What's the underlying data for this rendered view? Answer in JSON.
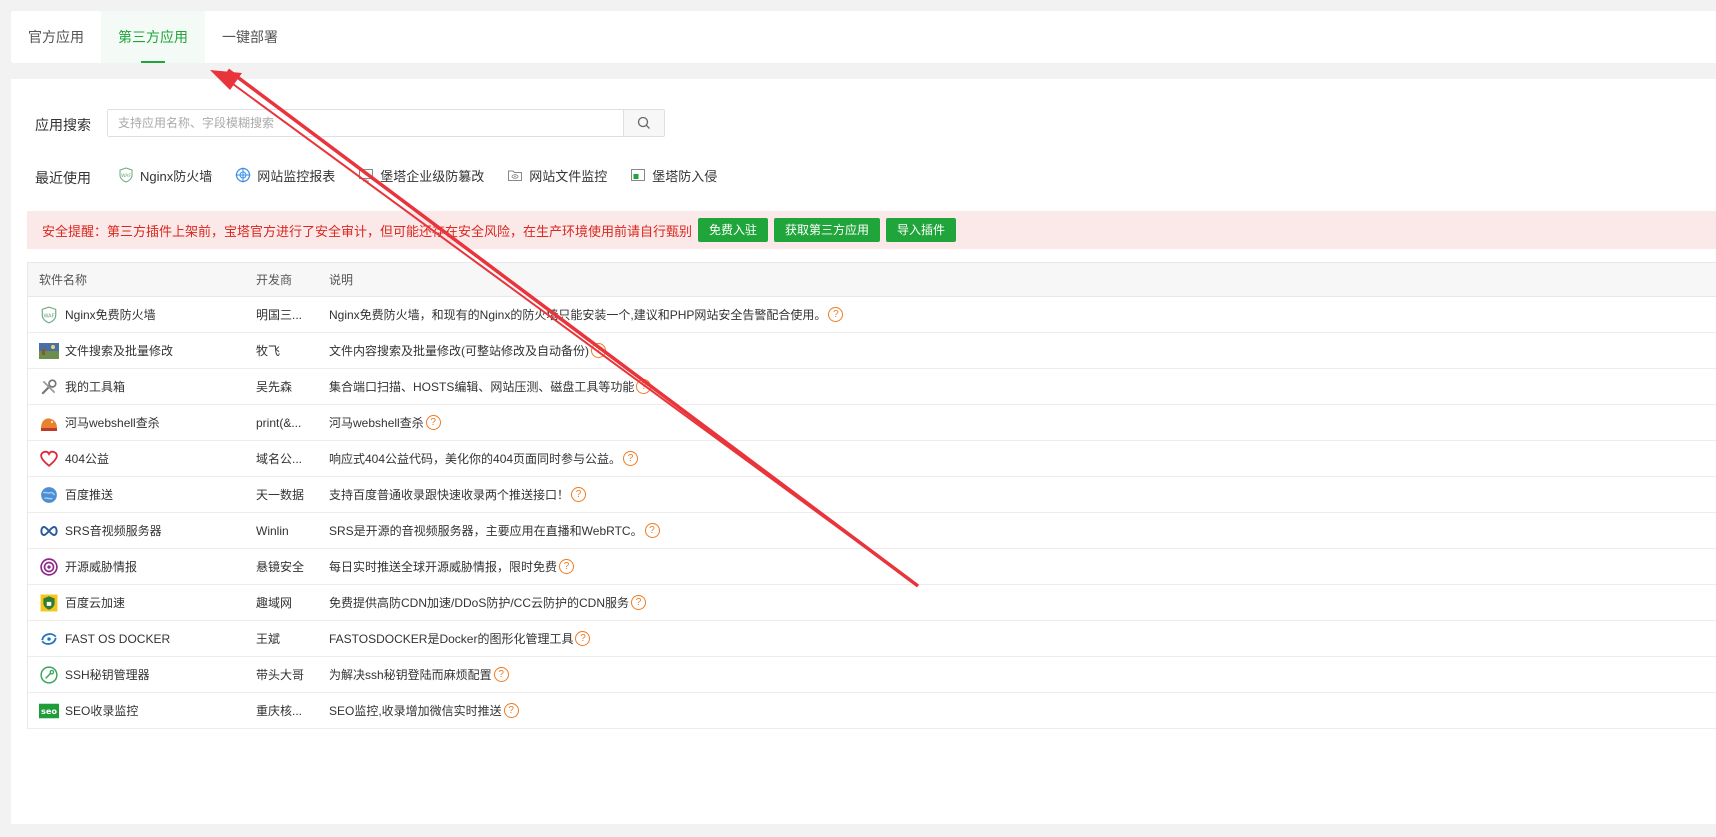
{
  "tabs": [
    {
      "label": "官方应用"
    },
    {
      "label": "第三方应用"
    },
    {
      "label": "一键部署"
    }
  ],
  "search": {
    "label": "应用搜索",
    "placeholder": "支持应用名称、字段模糊搜索"
  },
  "recent": {
    "label": "最近使用",
    "items": [
      {
        "label": "Nginx防火墙"
      },
      {
        "label": "网站监控报表"
      },
      {
        "label": "堡塔企业级防篡改"
      },
      {
        "label": "网站文件监控"
      },
      {
        "label": "堡塔防入侵"
      }
    ]
  },
  "alert": {
    "text": "安全提醒：第三方插件上架前，宝塔官方进行了安全审计，但可能还存在安全风险，在生产环境使用前请自行甄别",
    "buttons": [
      {
        "label": "免费入驻"
      },
      {
        "label": "获取第三方应用"
      },
      {
        "label": "导入插件"
      }
    ]
  },
  "table": {
    "headers": [
      "软件名称",
      "开发商",
      "说明"
    ],
    "rows": [
      {
        "name": "Nginx免费防火墙",
        "dev": "明国三...",
        "desc": "Nginx免费防火墙，和现有的Nginx的防火墙只能安装一个,建议和PHP网站安全告警配合使用。",
        "icon": "waf-shield-icon"
      },
      {
        "name": "文件搜索及批量修改",
        "dev": "牧飞",
        "desc": "文件内容搜索及批量修改(可整站修改及自动备份)",
        "icon": "landscape-image-icon"
      },
      {
        "name": "我的工具箱",
        "dev": "吴先森",
        "desc": "集合端口扫描、HOSTS编辑、网站压测、磁盘工具等功能",
        "icon": "tools-icon"
      },
      {
        "name": "河马webshell查杀",
        "dev": "print(&...",
        "desc": "河马webshell查杀",
        "icon": "hippo-icon"
      },
      {
        "name": "404公益",
        "dev": "域名公...",
        "desc": "响应式404公益代码，美化你的404页面同时参与公益。",
        "icon": "heart-icon"
      },
      {
        "name": "百度推送",
        "dev": "天一数据",
        "desc": "支持百度普通收录跟快速收录两个推送接口！",
        "icon": "globe-icon"
      },
      {
        "name": "SRS音视频服务器",
        "dev": "Winlin",
        "desc": "SRS是开源的音视频服务器，主要应用在直播和WebRTC。",
        "icon": "infinity-icon"
      },
      {
        "name": "开源威胁情报",
        "dev": "悬镜安全",
        "desc": "每日实时推送全球开源威胁情报，限时免费",
        "icon": "radar-icon"
      },
      {
        "name": "百度云加速",
        "dev": "趣域网",
        "desc": "免费提供高防CDN加速/DDoS防护/CC云防护的CDN服务",
        "icon": "shield-lock-icon"
      },
      {
        "name": "FAST OS DOCKER",
        "dev": "王斌",
        "desc": "FASTOSDOCKER是Docker的图形化管理工具",
        "icon": "docker-swirl-icon"
      },
      {
        "name": "SSH秘钥管理器",
        "dev": "带头大哥",
        "desc": "为解决ssh秘钥登陆而麻烦配置",
        "icon": "key-circle-icon"
      },
      {
        "name": "SEO收录监控",
        "dev": "重庆核...",
        "desc": "SEO监控,收录增加微信实时推送",
        "icon": "seo-icon"
      }
    ]
  },
  "colors": {
    "accent": "#20a53a",
    "alert_bg": "#fbe9e9",
    "alert_text": "#d9281e",
    "help_orange": "#f07a1f",
    "annotation_arrow": "#e8343a"
  }
}
